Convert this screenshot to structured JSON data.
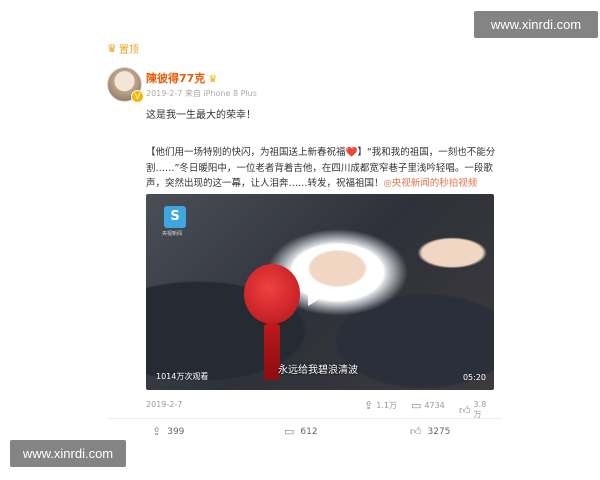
{
  "watermark": {
    "top": "www.xinrdi.com",
    "bottom": "www.xinrdi.com"
  },
  "post": {
    "pin_label": "置顶",
    "username": "陳彼得77克",
    "meta": "2019-2-7 来自 iPhone 8 Plus",
    "line1": "这是我一生最大的荣幸！",
    "text_main": "【他们用一场特别的快闪，为祖国送上新春祝福❤️】“我和我的祖国，一刻也不能分割……”冬日暖阳中，一位老者背着吉他，在四川成都宽窄巷子里浅吟轻唱。一段歌声，突然出现的这一幕，让人泪奔……转发，祝福祖国！",
    "text_link": "◎央视新闻的秒拍视频"
  },
  "video": {
    "logo_text": "S",
    "logo_label": "央视新闻",
    "views": "1014万次观看",
    "subtitle": "永远给我碧浪清波",
    "duration": "05:20"
  },
  "inner_actions": {
    "date": "2019-2-7",
    "share": "1.1万",
    "comment": "4734",
    "like": "3.8万"
  },
  "outer_actions": {
    "share": "399",
    "comment": "612",
    "like": "3275"
  },
  "icons": {
    "pin": "crown-icon",
    "share": "share-icon",
    "comment": "comment-icon",
    "like": "thumbs-up-icon",
    "play": "play-icon"
  },
  "colors": {
    "username": "#e85d0c",
    "link": "#eb7350",
    "pin": "#e8a317"
  }
}
